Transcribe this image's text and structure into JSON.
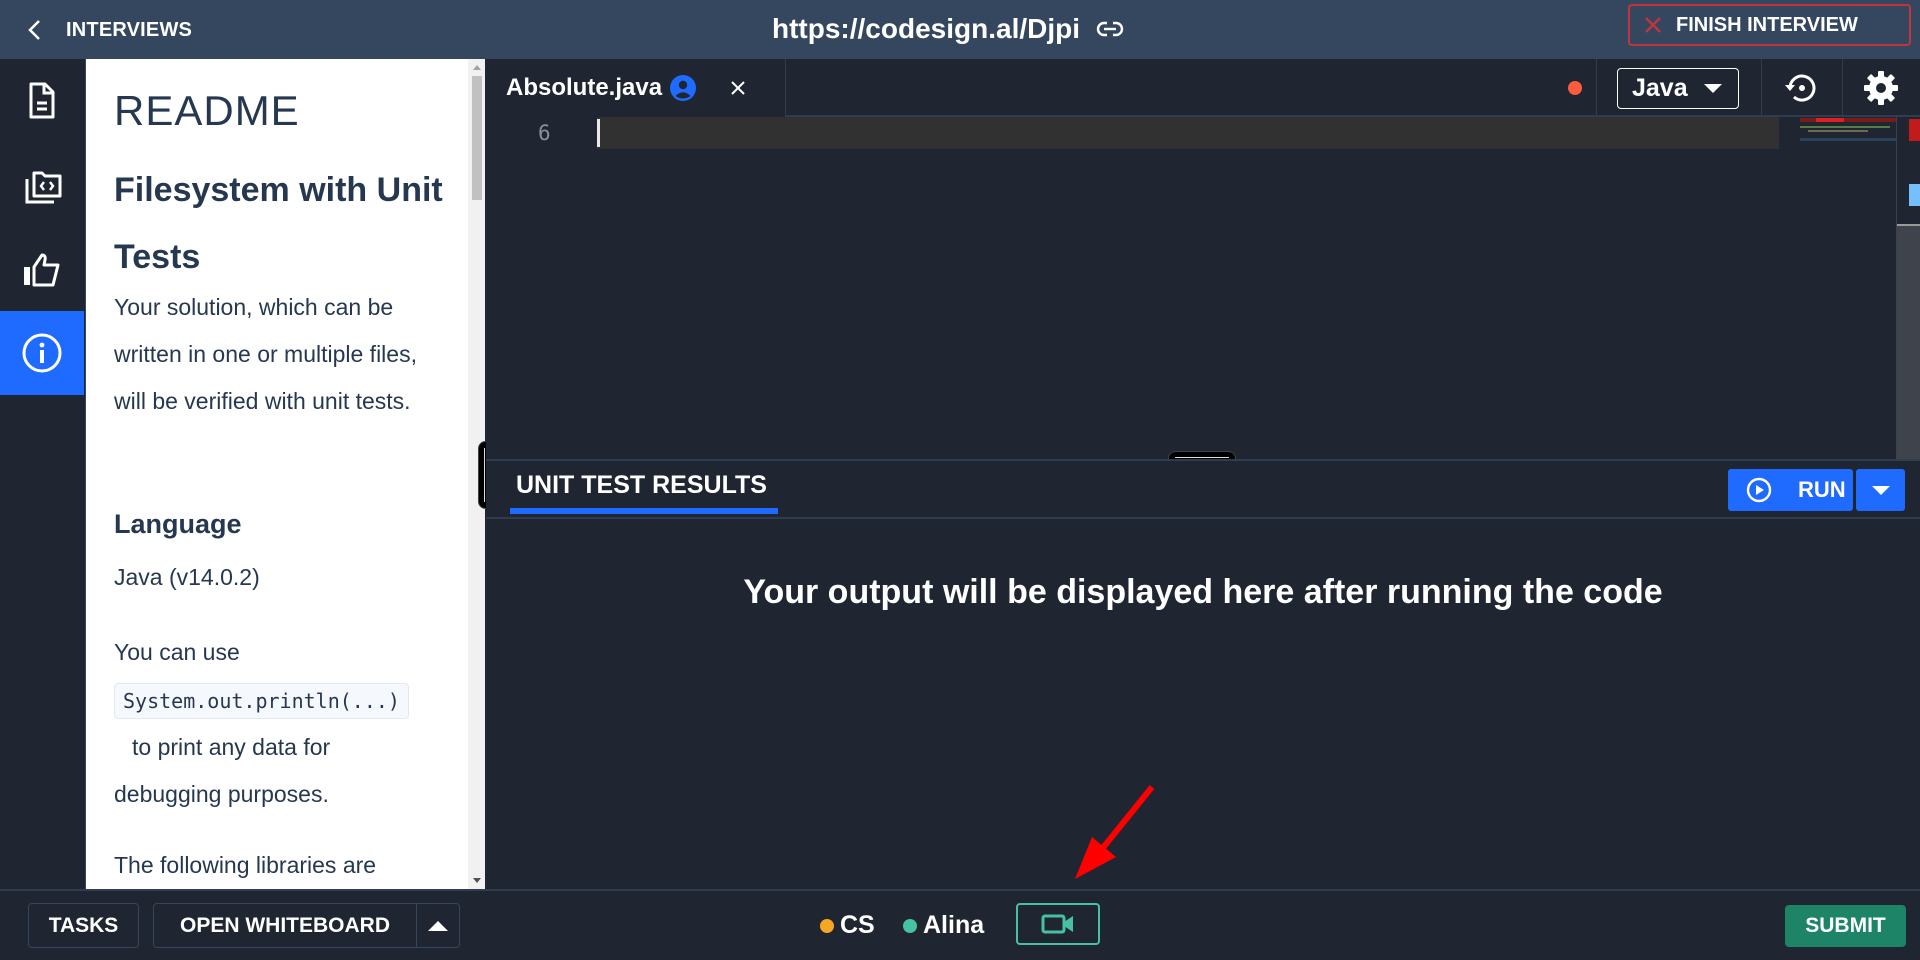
{
  "header": {
    "back_label": "INTERVIEWS",
    "url": "https://codesign.al/Djpi",
    "finish_label": "FINISH INTERVIEW"
  },
  "sidebar": {
    "items": [
      {
        "name": "document",
        "icon": "document-icon",
        "active": false
      },
      {
        "name": "code-folders",
        "icon": "code-folder-icon",
        "active": false
      },
      {
        "name": "feedback",
        "icon": "thumbs-up-icon",
        "active": false
      },
      {
        "name": "info",
        "icon": "info-icon",
        "active": true
      }
    ]
  },
  "readme": {
    "title": "README",
    "subtitle": "Filesystem with Unit Tests",
    "intro": "Your solution, which can be written in one or multiple files, will be verified with unit tests.",
    "language_heading": "Language",
    "language_value": "Java (v14.0.2)",
    "debug_prefix": "You can use",
    "debug_code": "System.out.println(...)",
    "debug_suffix": "to print any data for debugging purposes.",
    "libraries_text": "The following libraries are"
  },
  "editor": {
    "tab_name": "Absolute.java",
    "language": "Java",
    "unsaved": true,
    "line_number": "6",
    "colors": {
      "accent": "#1f6bff",
      "unsaved_dot": "#fb5b3e"
    }
  },
  "results": {
    "tab_label": "UNIT TEST RESULTS",
    "run_label": "RUN",
    "output_placeholder": "Your output will be displayed here after running the code"
  },
  "footer": {
    "tasks_label": "TASKS",
    "whiteboard_label": "OPEN WHITEBOARD",
    "participants": [
      {
        "name": "CS",
        "color": "#f5a623"
      },
      {
        "name": "Alina",
        "color": "#46c2a3"
      }
    ],
    "submit_label": "SUBMIT"
  }
}
